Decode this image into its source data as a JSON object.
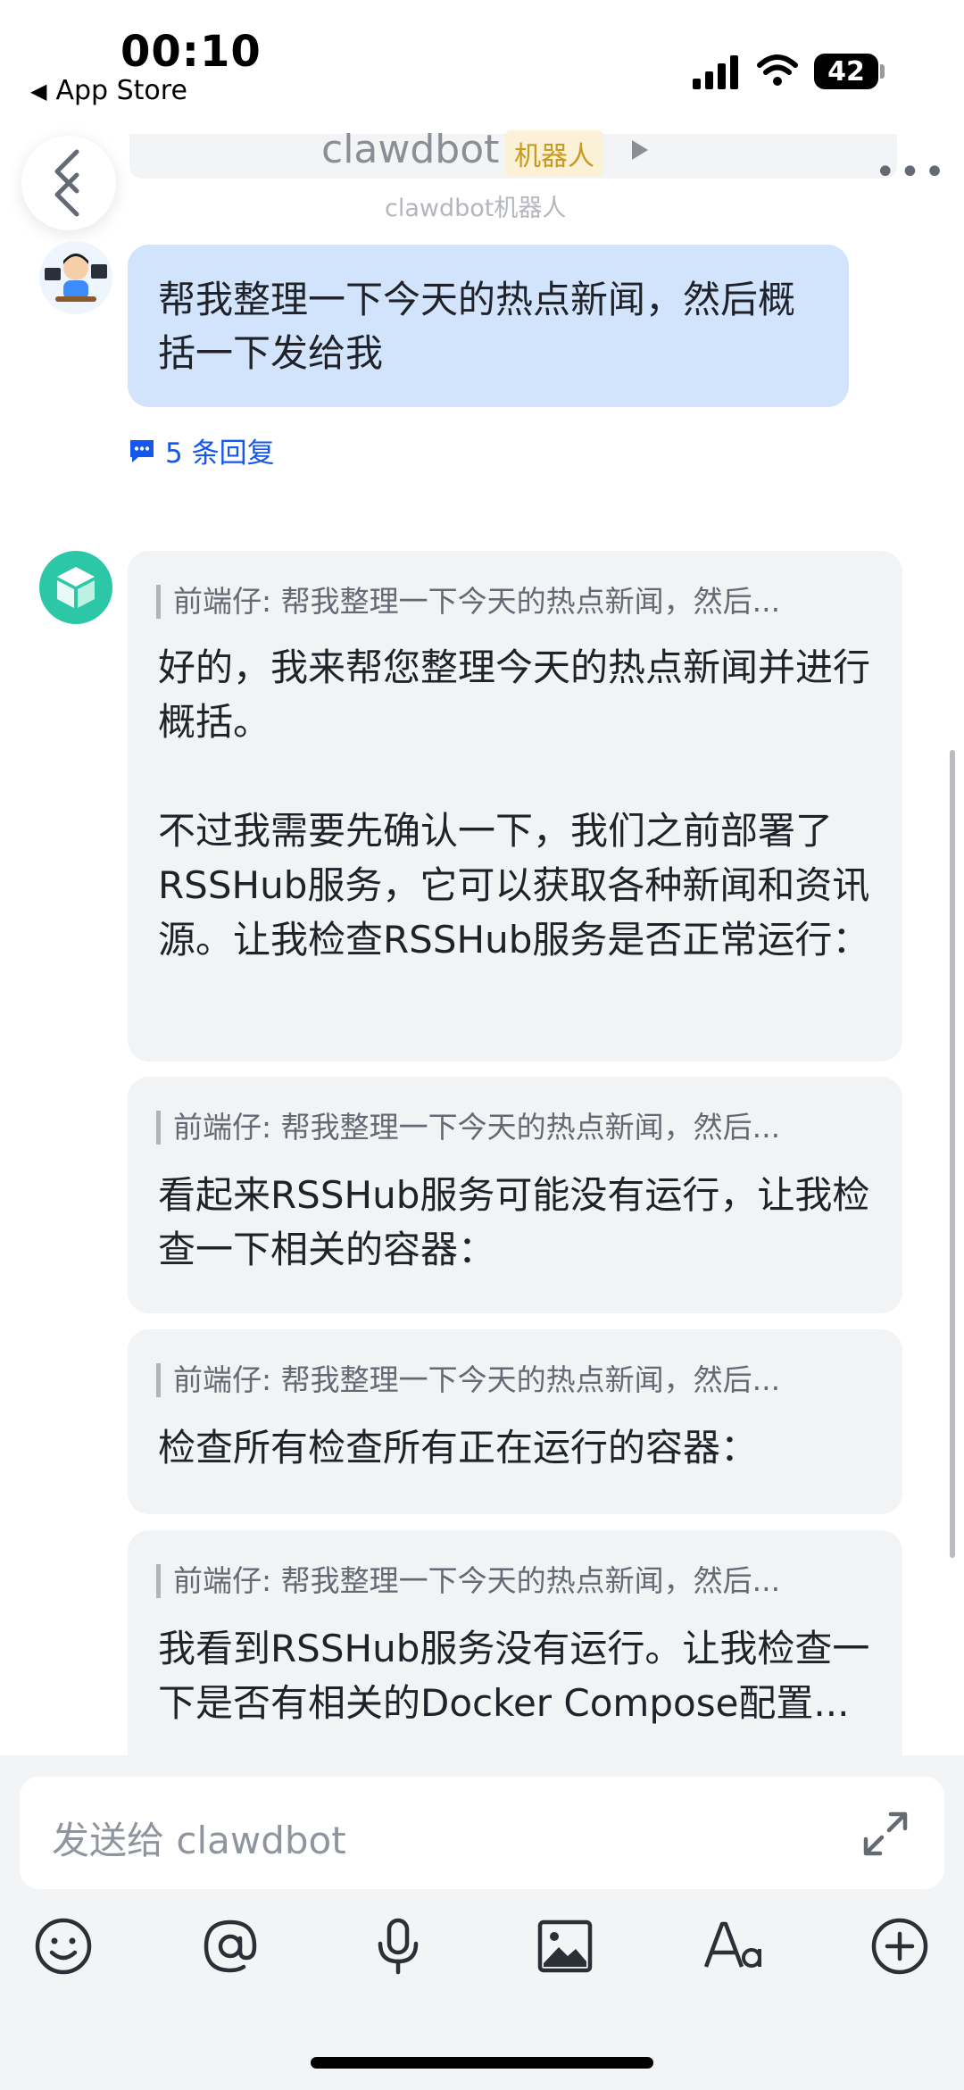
{
  "status_bar": {
    "time": "00:10",
    "back_app": "App Store",
    "battery": "42"
  },
  "header": {
    "title": "clawdbot",
    "tag": "机器人",
    "subtitle": "clawdbot机器人"
  },
  "user_message": {
    "text": "帮我整理一下今天的热点新闻，然后概括一下发给我",
    "replies": "5 条回复"
  },
  "bot_messages": [
    {
      "quote": "前端仔: 帮我整理一下今天的热点新闻，然后...",
      "text": "好的，我来帮您整理今天的热点新闻并进行概括。\n\n不过我需要先确认一下，我们之前部署了RSSHub服务，它可以获取各种新闻和资讯源。让我检查RSSHub服务是否正常运行："
    },
    {
      "quote": "前端仔: 帮我整理一下今天的热点新闻，然后...",
      "text": "看起来RSSHub服务可能没有运行，让我检查一下相关的容器："
    },
    {
      "quote": "前端仔: 帮我整理一下今天的热点新闻，然后...",
      "text": "检查所有检查所有正在运行的容器："
    },
    {
      "quote": "前端仔: 帮我整理一下今天的热点新闻，然后...",
      "text": "我看到RSSHub服务没有运行。让我检查一下是否有相关的Docker Compose配置..."
    }
  ],
  "composer": {
    "placeholder": "发送给 clawdbot"
  },
  "colors": {
    "accent": "#1456f0",
    "user_bubble": "#d2e3fc",
    "bot_bubble": "#f2f3f5",
    "bot_avatar": "#2bc7a6",
    "bot_tag_text": "#c99a20"
  },
  "icons": [
    "signal-icon",
    "wifi-icon",
    "battery-icon",
    "back-icon",
    "more-icon",
    "play-icon",
    "reply-icon",
    "cube-icon",
    "expand-icon",
    "emoji-icon",
    "mention-icon",
    "mic-icon",
    "image-icon",
    "font-icon",
    "add-icon"
  ]
}
